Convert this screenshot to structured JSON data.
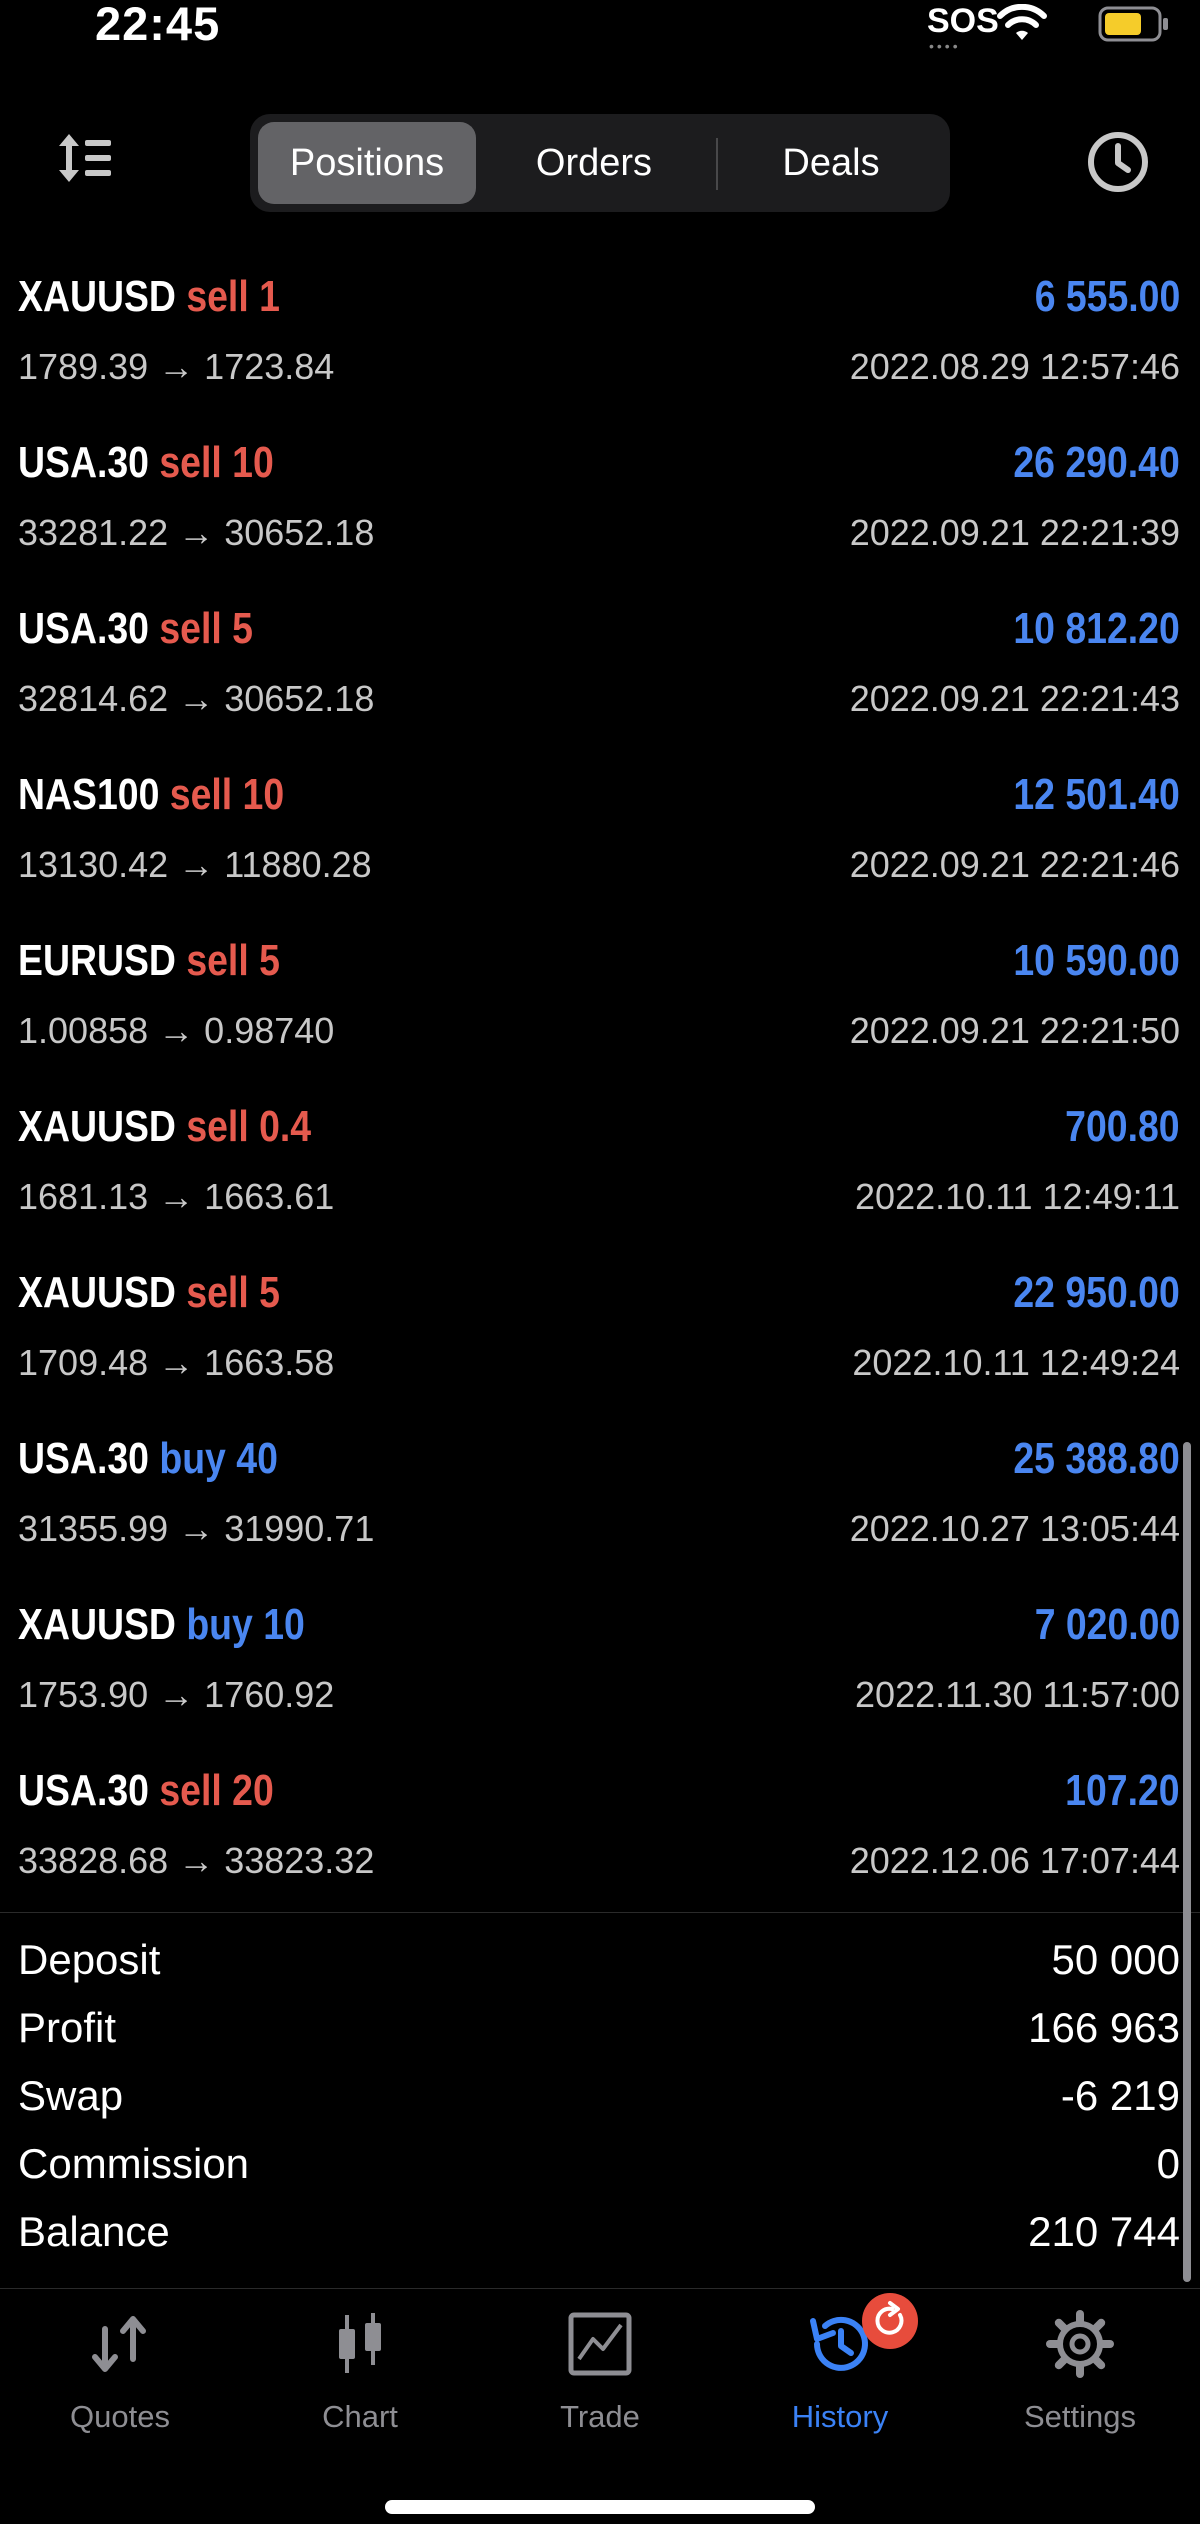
{
  "status_bar": {
    "time": "22:45",
    "sos": "SOS"
  },
  "tabs": [
    {
      "label": "Positions",
      "active": true
    },
    {
      "label": "Orders",
      "active": false
    },
    {
      "label": "Deals",
      "active": false
    }
  ],
  "positions": [
    {
      "symbol": "XAUUSD",
      "side": "sell",
      "volume": "1",
      "open_price": "1789.39",
      "close_price": "1723.84",
      "profit": "6 555.00",
      "time": "2022.08.29 12:57:46"
    },
    {
      "symbol": "USA.30",
      "side": "sell",
      "volume": "10",
      "open_price": "33281.22",
      "close_price": "30652.18",
      "profit": "26 290.40",
      "time": "2022.09.21 22:21:39"
    },
    {
      "symbol": "USA.30",
      "side": "sell",
      "volume": "5",
      "open_price": "32814.62",
      "close_price": "30652.18",
      "profit": "10 812.20",
      "time": "2022.09.21 22:21:43"
    },
    {
      "symbol": "NAS100",
      "side": "sell",
      "volume": "10",
      "open_price": "13130.42",
      "close_price": "11880.28",
      "profit": "12 501.40",
      "time": "2022.09.21 22:21:46"
    },
    {
      "symbol": "EURUSD",
      "side": "sell",
      "volume": "5",
      "open_price": "1.00858",
      "close_price": "0.98740",
      "profit": "10 590.00",
      "time": "2022.09.21 22:21:50"
    },
    {
      "symbol": "XAUUSD",
      "side": "sell",
      "volume": "0.4",
      "open_price": "1681.13",
      "close_price": "1663.61",
      "profit": "700.80",
      "time": "2022.10.11 12:49:11"
    },
    {
      "symbol": "XAUUSD",
      "side": "sell",
      "volume": "5",
      "open_price": "1709.48",
      "close_price": "1663.58",
      "profit": "22 950.00",
      "time": "2022.10.11 12:49:24"
    },
    {
      "symbol": "USA.30",
      "side": "buy",
      "volume": "40",
      "open_price": "31355.99",
      "close_price": "31990.71",
      "profit": "25 388.80",
      "time": "2022.10.27 13:05:44"
    },
    {
      "symbol": "XAUUSD",
      "side": "buy",
      "volume": "10",
      "open_price": "1753.90",
      "close_price": "1760.92",
      "profit": "7 020.00",
      "time": "2022.11.30 11:57:00"
    },
    {
      "symbol": "USA.30",
      "side": "sell",
      "volume": "20",
      "open_price": "33828.68",
      "close_price": "33823.32",
      "profit": "107.20",
      "time": "2022.12.06 17:07:44"
    }
  ],
  "arrow": "→",
  "summary": [
    {
      "label": "Deposit",
      "value": "50 000"
    },
    {
      "label": "Profit",
      "value": "166 963"
    },
    {
      "label": "Swap",
      "value": "-6 219"
    },
    {
      "label": "Commission",
      "value": "0"
    },
    {
      "label": "Balance",
      "value": "210 744"
    }
  ],
  "tabbar": [
    {
      "label": "Quotes",
      "icon": "quotes-arrows-icon",
      "active": false
    },
    {
      "label": "Chart",
      "icon": "candlestick-icon",
      "active": false
    },
    {
      "label": "Trade",
      "icon": "trade-chart-icon",
      "active": false
    },
    {
      "label": "History",
      "icon": "history-clock-icon",
      "active": true
    },
    {
      "label": "Settings",
      "icon": "gear-icon",
      "active": false
    }
  ],
  "colors": {
    "sell": "#e55a4e",
    "buy": "#4a86f0",
    "profit": "#4a86f0",
    "active_tab": "#3b82f6",
    "badge": "#e74c3c"
  }
}
